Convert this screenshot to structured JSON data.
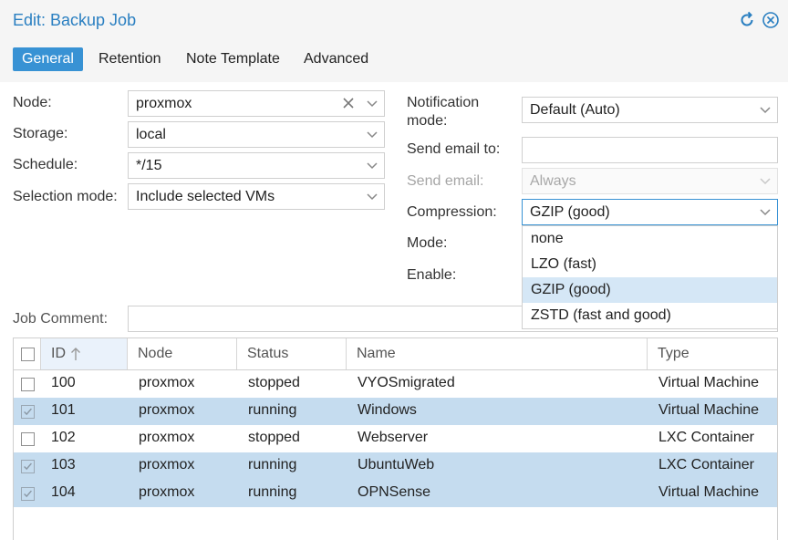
{
  "window": {
    "title": "Edit: Backup Job"
  },
  "tabs": [
    {
      "label": "General",
      "active": true
    },
    {
      "label": "Retention"
    },
    {
      "label": "Note Template"
    },
    {
      "label": "Advanced"
    }
  ],
  "left_form": {
    "node": {
      "label": "Node:",
      "value": "proxmox"
    },
    "storage": {
      "label": "Storage:",
      "value": "local"
    },
    "schedule": {
      "label": "Schedule:",
      "value": "*/15"
    },
    "selection_mode": {
      "label": "Selection mode:",
      "value": "Include selected VMs"
    }
  },
  "right_form": {
    "notification_mode": {
      "label_line1": "Notification",
      "label_line2": "mode:",
      "value": "Default (Auto)"
    },
    "send_email_to": {
      "label": "Send email to:",
      "value": ""
    },
    "send_email": {
      "label": "Send email:",
      "value": "Always",
      "disabled": true
    },
    "compression": {
      "label": "Compression:",
      "value": "GZIP (good)"
    },
    "mode": {
      "label": "Mode:"
    },
    "enable": {
      "label": "Enable:"
    }
  },
  "compression_options": [
    {
      "label": "none"
    },
    {
      "label": "LZO (fast)"
    },
    {
      "label": "GZIP (good)",
      "selected": true
    },
    {
      "label": "ZSTD (fast and good)"
    }
  ],
  "job_comment": {
    "label": "Job Comment:",
    "value": ""
  },
  "grid": {
    "columns": [
      "ID",
      "Node",
      "Status",
      "Name",
      "Type"
    ],
    "sort_column": "ID",
    "sort_direction": "ascending",
    "rows": [
      {
        "id": "100",
        "node": "proxmox",
        "status": "stopped",
        "name": "VYOSmigrated",
        "type": "Virtual Machine",
        "checked": false
      },
      {
        "id": "101",
        "node": "proxmox",
        "status": "running",
        "name": "Windows",
        "type": "Virtual Machine",
        "checked": true
      },
      {
        "id": "102",
        "node": "proxmox",
        "status": "stopped",
        "name": "Webserver",
        "type": "LXC Container",
        "checked": false
      },
      {
        "id": "103",
        "node": "proxmox",
        "status": "running",
        "name": "UbuntuWeb",
        "type": "LXC Container",
        "checked": true
      },
      {
        "id": "104",
        "node": "proxmox",
        "status": "running",
        "name": "OPNSense",
        "type": "Virtual Machine",
        "checked": true
      }
    ]
  },
  "icons": {
    "reset": "reset-icon",
    "close": "close-icon"
  },
  "colors": {
    "accent": "#3892d4",
    "title": "#2a7fc1",
    "selected_row": "#c5dcef",
    "hover_option": "#d5e7f6"
  }
}
